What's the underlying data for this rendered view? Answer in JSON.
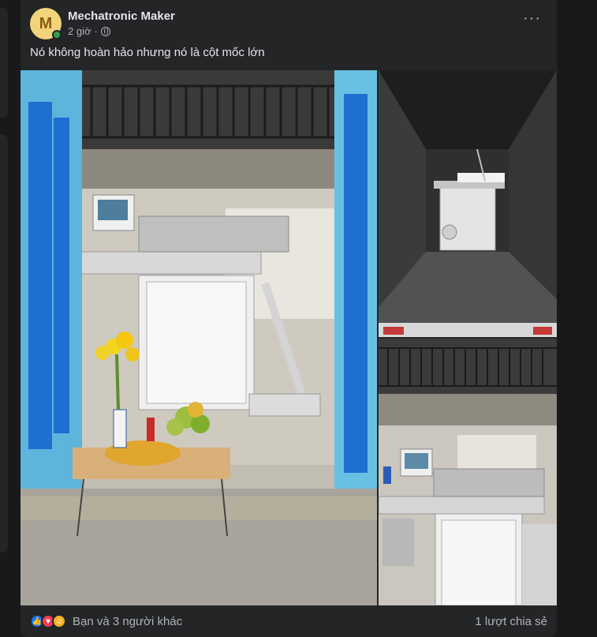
{
  "post": {
    "avatar_letter": "M",
    "author": "Mechatronic Maker",
    "time": "2 giờ",
    "caption": "Nó không hoàn hảo nhưng nó là cột mốc lớn",
    "reactions_text": "Bạn và 3 người khác",
    "shares_text": "1 lượt chia sẻ"
  },
  "icons": {
    "more": "more-options-icon",
    "privacy": "globe-icon",
    "reactions": [
      "like-icon",
      "love-icon",
      "care-icon"
    ]
  },
  "colors": {
    "card_bg": "#242526",
    "page_bg": "#18191a",
    "online": "#31a24c",
    "like": "#1877f2",
    "love": "#f33e58"
  }
}
